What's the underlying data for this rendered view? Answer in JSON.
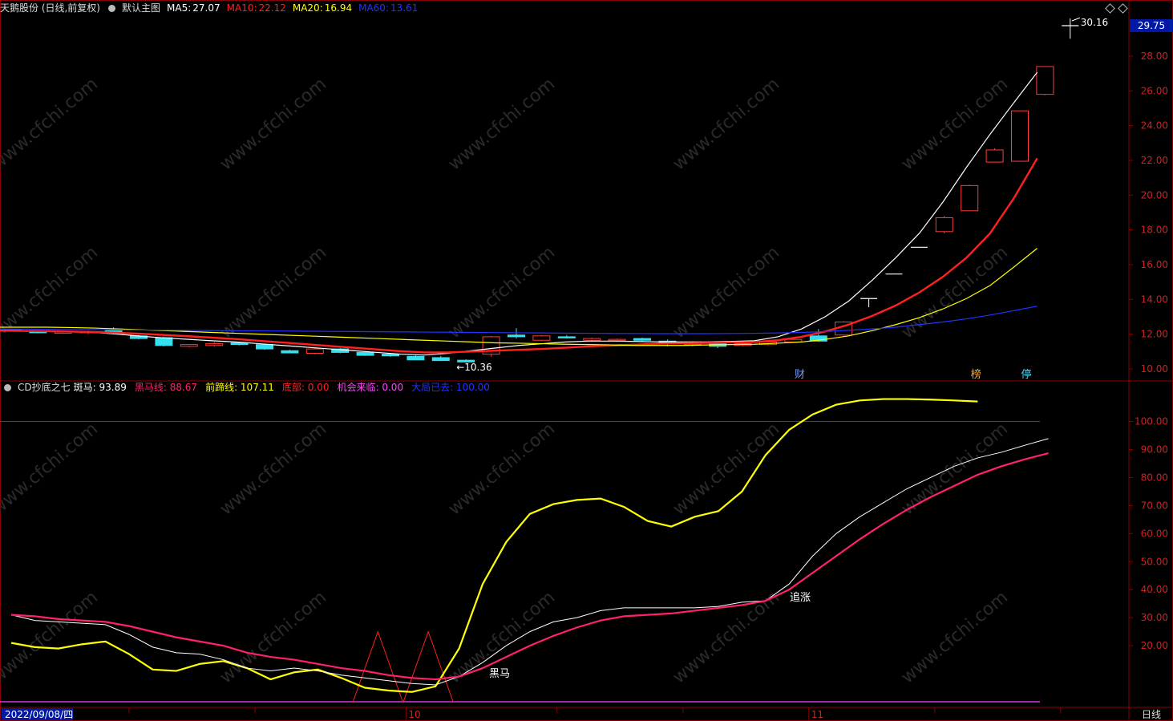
{
  "main_header": {
    "stock": "天鹅股份 (日线,前复权)",
    "template": "默认主图",
    "ma5": {
      "label": "MA5:",
      "value": "27.07",
      "color": "#ffffff"
    },
    "ma10": {
      "label": "MA10:",
      "value": "22.12",
      "color": "#ff2020"
    },
    "ma20": {
      "label": "MA20:",
      "value": "16.94",
      "color": "#ffff00"
    },
    "ma60": {
      "label": "MA60:",
      "value": "13.61",
      "color": "#2233ff"
    }
  },
  "sub_header": {
    "name": "CD抄底之七",
    "items": [
      {
        "label": "斑马:",
        "value": "93.89",
        "color": "#ffffff"
      },
      {
        "label": "黑马线:",
        "value": "88.67",
        "color": "#ff2266"
      },
      {
        "label": "前蹄线:",
        "value": "107.11",
        "color": "#ffff00"
      },
      {
        "label": "底部:",
        "value": "0.00",
        "color": "#ff2020"
      },
      {
        "label": "机会来临:",
        "value": "0.00",
        "color": "#ff44ff"
      },
      {
        "label": "大局已去:",
        "value": "100.00",
        "color": "#2233ff"
      }
    ]
  },
  "price_axis": {
    "current": "29.75",
    "ticks": [
      "28.00",
      "26.00",
      "24.00",
      "22.00",
      "20.00",
      "18.00",
      "16.00",
      "14.00",
      "12.00",
      "10.00"
    ]
  },
  "ind_axis": {
    "ticks": [
      "100.00",
      "90.00",
      "80.00",
      "70.00",
      "60.00",
      "50.00",
      "40.00",
      "30.00",
      "20.00"
    ]
  },
  "date_label": "2022/09/08/四",
  "period_label": "日线",
  "month_labels": [
    "10",
    "11"
  ],
  "annotations": {
    "high": "30.16",
    "low": "10.36",
    "heima": "黑马",
    "zhuizhang": "追涨",
    "markers": [
      "财",
      "榜",
      "停"
    ]
  },
  "watermark": "www.cfchi.com",
  "colors": {
    "up": "#ff3a3a",
    "down": "#34e0f0",
    "grid": "#8b0000",
    "flat": "#ffffff"
  },
  "chart_data": {
    "type": "candlestick",
    "candles": [
      {
        "o": 12.22,
        "h": 12.3,
        "l": 12.15,
        "c": 12.25
      },
      {
        "o": 12.15,
        "h": 12.22,
        "l": 12.05,
        "c": 12.08
      },
      {
        "o": 12.08,
        "h": 12.18,
        "l": 12.02,
        "c": 12.12
      },
      {
        "o": 12.1,
        "h": 12.2,
        "l": 12.0,
        "c": 12.15
      },
      {
        "o": 12.2,
        "h": 12.4,
        "l": 12.1,
        "c": 12.18
      },
      {
        "o": 11.9,
        "h": 11.95,
        "l": 11.7,
        "c": 11.75
      },
      {
        "o": 11.8,
        "h": 11.85,
        "l": 11.3,
        "c": 11.35
      },
      {
        "o": 11.3,
        "h": 11.42,
        "l": 11.25,
        "c": 11.4
      },
      {
        "o": 11.35,
        "h": 11.55,
        "l": 11.28,
        "c": 11.45
      },
      {
        "o": 11.5,
        "h": 11.55,
        "l": 11.35,
        "c": 11.4
      },
      {
        "o": 11.4,
        "h": 11.45,
        "l": 11.1,
        "c": 11.15
      },
      {
        "o": 11.05,
        "h": 11.1,
        "l": 10.9,
        "c": 10.92
      },
      {
        "o": 10.9,
        "h": 11.2,
        "l": 10.85,
        "c": 11.15
      },
      {
        "o": 11.15,
        "h": 11.2,
        "l": 10.9,
        "c": 10.95
      },
      {
        "o": 10.95,
        "h": 11.0,
        "l": 10.75,
        "c": 10.78
      },
      {
        "o": 10.85,
        "h": 10.92,
        "l": 10.7,
        "c": 10.75
      },
      {
        "o": 10.72,
        "h": 10.78,
        "l": 10.5,
        "c": 10.52
      },
      {
        "o": 10.65,
        "h": 10.75,
        "l": 10.45,
        "c": 10.48
      },
      {
        "o": 10.5,
        "h": 10.55,
        "l": 10.36,
        "c": 10.4
      },
      {
        "o": 10.85,
        "h": 11.9,
        "l": 10.7,
        "c": 11.85
      },
      {
        "o": 11.95,
        "h": 12.35,
        "l": 11.75,
        "c": 11.85
      },
      {
        "o": 11.65,
        "h": 11.95,
        "l": 11.6,
        "c": 11.9
      },
      {
        "o": 11.85,
        "h": 11.95,
        "l": 11.75,
        "c": 11.8
      },
      {
        "o": 11.65,
        "h": 11.8,
        "l": 11.55,
        "c": 11.75
      },
      {
        "o": 11.65,
        "h": 11.75,
        "l": 11.55,
        "c": 11.7
      },
      {
        "o": 11.75,
        "h": 11.8,
        "l": 11.6,
        "c": 11.65
      },
      {
        "o": 11.6,
        "h": 11.7,
        "l": 11.3,
        "c": 11.45
      },
      {
        "o": 11.4,
        "h": 11.6,
        "l": 11.3,
        "c": 11.55
      },
      {
        "o": 11.45,
        "h": 11.5,
        "l": 11.2,
        "c": 11.3
      },
      {
        "o": 11.35,
        "h": 11.5,
        "l": 11.3,
        "c": 11.45
      },
      {
        "o": 11.4,
        "h": 11.6,
        "l": 11.35,
        "c": 11.55
      },
      {
        "o": 11.55,
        "h": 11.75,
        "l": 11.5,
        "c": 11.7
      },
      {
        "o": 11.9,
        "h": 12.3,
        "l": 11.55,
        "c": 11.6
      },
      {
        "o": 11.95,
        "h": 12.75,
        "l": 11.9,
        "c": 12.7
      },
      {
        "o": 14.05,
        "h": 14.05,
        "l": 13.55,
        "c": 14.05
      },
      {
        "o": 15.46,
        "h": 15.46,
        "l": 15.46,
        "c": 15.46
      },
      {
        "o": 17.0,
        "h": 17.0,
        "l": 17.0,
        "c": 17.0
      },
      {
        "o": 17.9,
        "h": 18.8,
        "l": 17.8,
        "c": 18.7
      },
      {
        "o": 19.1,
        "h": 20.6,
        "l": 19.1,
        "c": 20.55
      },
      {
        "o": 21.9,
        "h": 22.7,
        "l": 21.9,
        "c": 22.6
      },
      {
        "o": 21.95,
        "h": 24.85,
        "l": 21.95,
        "c": 24.85
      },
      {
        "o": 25.8,
        "h": 27.4,
        "l": 25.75,
        "c": 27.4
      },
      {
        "o": 29.75,
        "h": 30.16,
        "l": 29.0,
        "c": 29.75
      }
    ],
    "ma": [
      {
        "name": "MA5",
        "color": "#ffffff",
        "values": [
          12.23,
          12.2,
          12.18,
          12.15,
          12.1,
          12.0,
          11.88,
          11.78,
          11.7,
          11.62,
          11.55,
          11.45,
          11.35,
          11.25,
          11.15,
          11.05,
          10.95,
          10.85,
          10.8,
          10.9,
          11.05,
          11.2,
          11.35,
          11.45,
          11.55,
          11.6,
          11.6,
          11.58,
          11.55,
          11.55,
          11.55,
          11.58,
          11.62,
          11.85,
          12.3,
          13.0,
          13.9,
          15.1,
          16.4,
          17.8,
          19.6,
          21.6,
          23.5,
          25.3,
          27.07
        ]
      },
      {
        "name": "MA10",
        "color": "#ff2020",
        "values": [
          12.2,
          12.19,
          12.17,
          12.15,
          12.12,
          12.08,
          12.02,
          11.95,
          11.88,
          11.8,
          11.72,
          11.62,
          11.52,
          11.42,
          11.32,
          11.22,
          11.12,
          11.02,
          10.95,
          10.95,
          11.0,
          11.05,
          11.1,
          11.15,
          11.22,
          11.3,
          11.35,
          11.4,
          11.45,
          11.48,
          11.5,
          11.52,
          11.55,
          11.65,
          11.85,
          12.15,
          12.55,
          13.05,
          13.65,
          14.4,
          15.3,
          16.4,
          17.8,
          19.8,
          22.12
        ]
      },
      {
        "name": "MA20",
        "color": "#ffff00",
        "values": [
          12.4,
          12.4,
          12.4,
          12.38,
          12.35,
          12.3,
          12.25,
          12.2,
          12.15,
          12.1,
          12.05,
          12.0,
          11.95,
          11.9,
          11.85,
          11.8,
          11.75,
          11.7,
          11.65,
          11.6,
          11.55,
          11.5,
          11.48,
          11.45,
          11.42,
          11.4,
          11.38,
          11.35,
          11.35,
          11.35,
          11.38,
          11.4,
          11.42,
          11.48,
          11.55,
          11.7,
          11.9,
          12.2,
          12.55,
          12.95,
          13.45,
          14.05,
          14.8,
          15.85,
          16.94
        ]
      },
      {
        "name": "MA60",
        "color": "#2233ff",
        "values": [
          12.3,
          12.29,
          12.28,
          12.27,
          12.26,
          12.25,
          12.24,
          12.23,
          12.22,
          12.21,
          12.2,
          12.19,
          12.18,
          12.17,
          12.16,
          12.15,
          12.14,
          12.13,
          12.12,
          12.11,
          12.1,
          12.09,
          12.08,
          12.07,
          12.06,
          12.05,
          12.04,
          12.04,
          12.03,
          12.03,
          12.03,
          12.04,
          12.05,
          12.07,
          12.1,
          12.15,
          12.22,
          12.3,
          12.4,
          12.55,
          12.7,
          12.88,
          13.1,
          13.35,
          13.61
        ]
      }
    ],
    "indicator": {
      "zebra": {
        "name": "斑马",
        "color": "#ffffff",
        "values": [
          31,
          29,
          28.5,
          28,
          27.5,
          24,
          19.5,
          17.5,
          17,
          15,
          12,
          11,
          12,
          11,
          9.5,
          8.5,
          7.5,
          6.5,
          6,
          9,
          14,
          20,
          25,
          28.5,
          30,
          32.5,
          33.5,
          33.5,
          33.5,
          33.5,
          34,
          35.5,
          36,
          42,
          52,
          60,
          66,
          71,
          76,
          80,
          84,
          87,
          89,
          91.5,
          93.89
        ]
      },
      "heima": {
        "name": "黑马线",
        "color": "#ff2266",
        "values": [
          31,
          30.5,
          29.5,
          29,
          28.5,
          27,
          25,
          23,
          21.5,
          20,
          17.5,
          16,
          15,
          13.5,
          12,
          11,
          9.5,
          8.5,
          8,
          9,
          12,
          16,
          20,
          23.5,
          26.5,
          29,
          30.5,
          31,
          31.5,
          32.5,
          33.5,
          34.5,
          36,
          40,
          46,
          52,
          58,
          63.5,
          68.5,
          73,
          77,
          81,
          84,
          86.5,
          88.67
        ]
      },
      "qianti": {
        "name": "前蹄线",
        "color": "#ffff00",
        "values": [
          21,
          19.5,
          19,
          20.5,
          21.5,
          17,
          11.5,
          11,
          13.5,
          14.5,
          12,
          8,
          10.5,
          11.5,
          8.5,
          5,
          4,
          3.5,
          5.5,
          19,
          42,
          57,
          67,
          70.5,
          72,
          72.5,
          69.5,
          64.5,
          62.5,
          66,
          68,
          75,
          88,
          97,
          102.5,
          106,
          107.5,
          108,
          108,
          107.8,
          107.5,
          107.11
        ]
      },
      "peaks": [
        14.5,
        16.5
      ],
      "blue_level": 100,
      "purple_level": 0
    }
  }
}
